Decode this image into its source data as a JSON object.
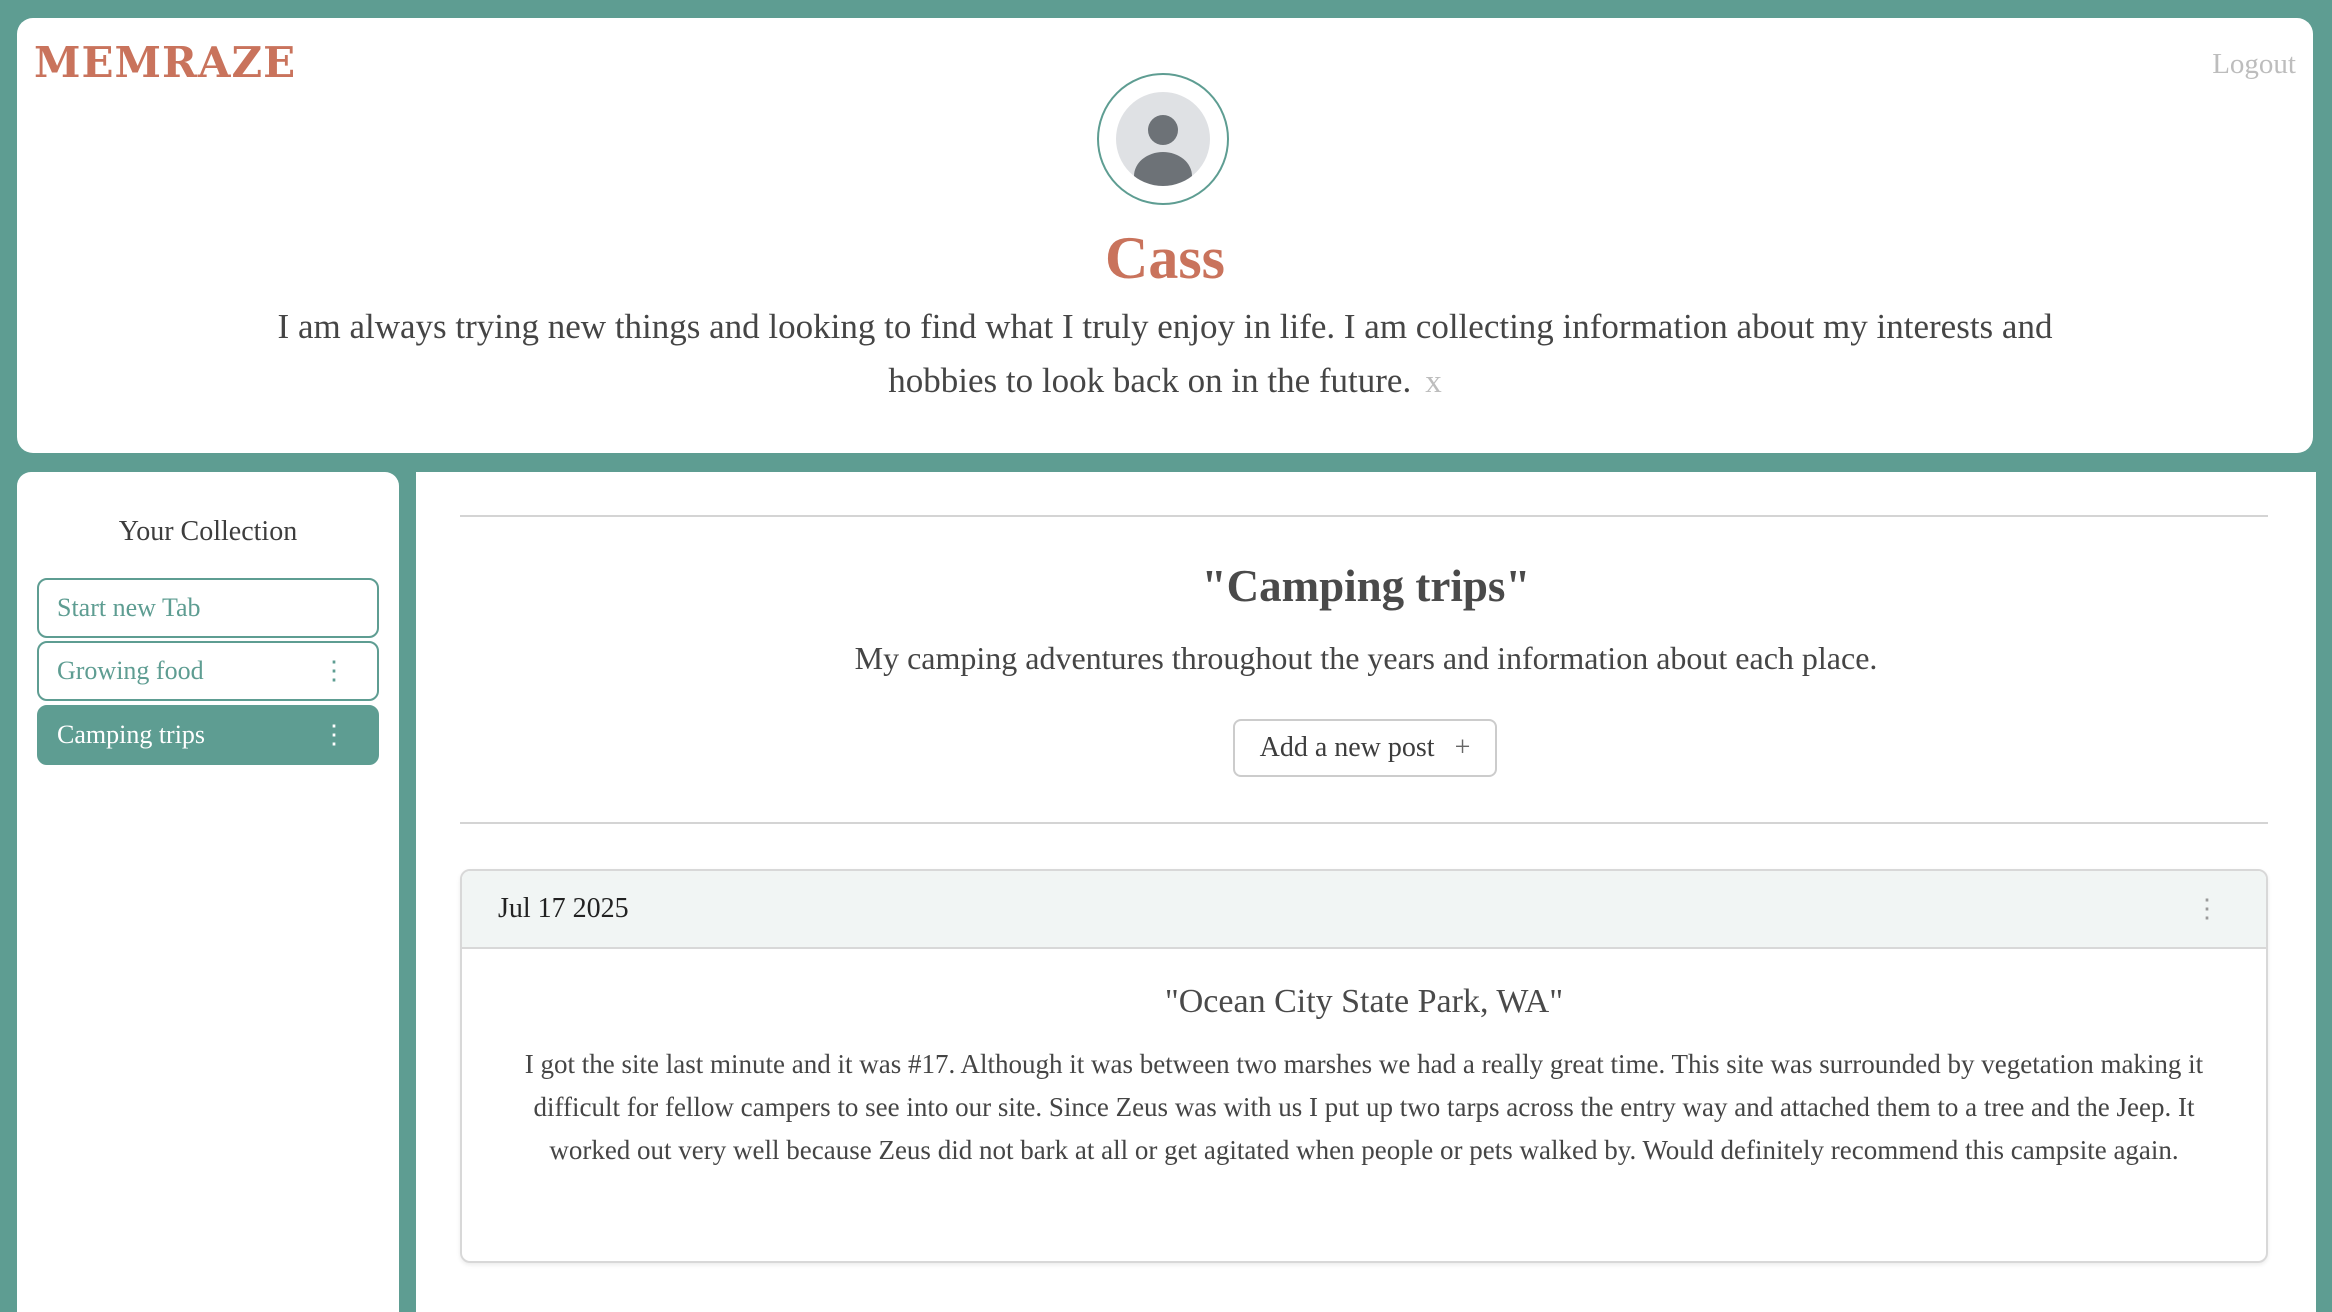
{
  "brand": {
    "name": "MEMRAZE",
    "color": "#c9735c"
  },
  "header": {
    "logout_label": "Logout",
    "avatar_icon": "user-avatar-icon",
    "profile_name": "Cass",
    "bio": "I am always trying new things and looking to find what I truly enjoy in life. I am collecting information about my interests and hobbies to look back on in the future.",
    "bio_close_label": "x"
  },
  "sidebar": {
    "title": "Your Collection",
    "items": [
      {
        "label": "Start new Tab",
        "menu_icon": "",
        "active": false
      },
      {
        "label": "Growing food",
        "menu_icon": "⋮",
        "active": false
      },
      {
        "label": "Camping trips",
        "menu_icon": "⋮",
        "active": true
      }
    ]
  },
  "main": {
    "tab_title": "\"Camping trips\"",
    "tab_description": "My camping adventures throughout the years and information about each place.",
    "add_post_label": "Add a new post",
    "add_post_icon": "+",
    "posts": [
      {
        "date": "Jul 17 2025",
        "menu_icon": "⋮",
        "title": "\"Ocean City State Park, WA\"",
        "body": "I got the site last minute and it was #17. Although it was between two marshes we had a really great time. This site was surrounded by vegetation making it difficult for fellow campers to see into our site. Since Zeus was with us I put up two tarps across the entry way and attached them to a tree and the Jeep. It worked out very well because Zeus did not bark at all or get agitated when people or pets walked by. Would definitely recommend this campsite again."
      }
    ]
  },
  "colors": {
    "accent": "#5e9d92",
    "brand": "#c9735c",
    "background": "#5e9d92"
  }
}
